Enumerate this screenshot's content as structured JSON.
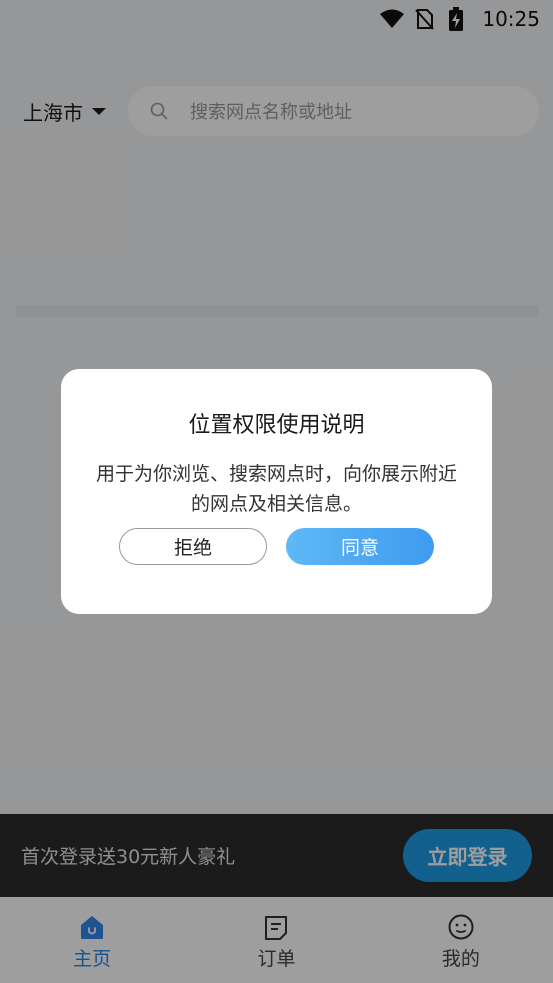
{
  "status_bar": {
    "time": "10:25",
    "icons": [
      "wifi-icon",
      "no-sim-icon",
      "battery-charging-icon"
    ]
  },
  "header": {
    "city": "上海市",
    "search_placeholder": "搜索网点名称或地址"
  },
  "dialog": {
    "title": "位置权限使用说明",
    "body": "用于为你浏览、搜索网点时，向你展示附近的网点及相关信息。",
    "reject_label": "拒绝",
    "agree_label": "同意"
  },
  "promo": {
    "text": "首次登录送30元新人豪礼",
    "button_label": "立即登录"
  },
  "tabbar": {
    "items": [
      {
        "label": "主页",
        "icon": "home-icon",
        "active": true
      },
      {
        "label": "订单",
        "icon": "order-icon",
        "active": false
      },
      {
        "label": "我的",
        "icon": "profile-icon",
        "active": false
      }
    ]
  },
  "colors": {
    "accent": "#1e88e5",
    "promo_button": "#1e9be6",
    "promo_bar": "#2d2d2d",
    "agree_gradient_start": "#5fb8f6",
    "agree_gradient_end": "#3e9bf0"
  }
}
